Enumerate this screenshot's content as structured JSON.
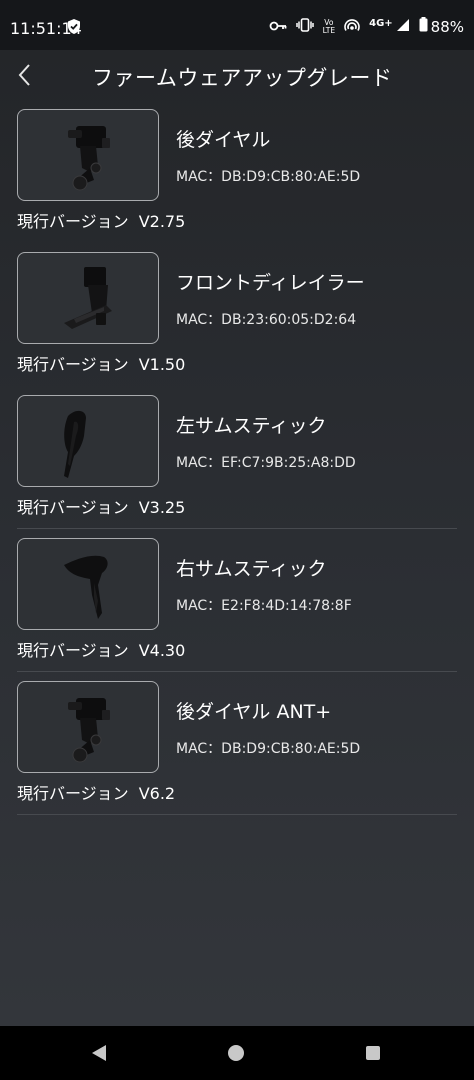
{
  "status_bar": {
    "time": "11:51:14",
    "network": "4G+",
    "volte_top": "Vo",
    "volte_bottom": "LTE",
    "battery": "88%"
  },
  "header": {
    "title": "ファームウェアアップグレード"
  },
  "devices": [
    {
      "name": "後ダイヤル",
      "mac": "MAC：DB:D9:CB:80:AE:5D",
      "version_label": "現行バージョン",
      "version": "V2.75"
    },
    {
      "name": "フロントディレイラー",
      "mac": "MAC：DB:23:60:05:D2:64",
      "version_label": "現行バージョン",
      "version": "V1.50"
    },
    {
      "name": "左サムスティック",
      "mac": "MAC：EF:C7:9B:25:A8:DD",
      "version_label": "現行バージョン",
      "version": "V3.25"
    },
    {
      "name": "右サムスティック",
      "mac": "MAC：E2:F8:4D:14:78:8F",
      "version_label": "現行バージョン",
      "version": "V4.30"
    },
    {
      "name": "後ダイヤル ANT+",
      "mac": "MAC：DB:D9:CB:80:AE:5D",
      "version_label": "現行バージョン",
      "version": "V6.2"
    }
  ],
  "icons": {
    "back": "chevron-left-icon",
    "shield": "shield-check-icon",
    "key": "key-icon",
    "vibrate": "vibrate-icon",
    "hotspot": "hotspot-icon",
    "signal": "signal-icon",
    "battery": "battery-icon",
    "nav_back": "triangle-back-icon",
    "nav_home": "circle-home-icon",
    "nav_recent": "square-recent-icon"
  },
  "colors": {
    "status_bar_bg": "#15171a",
    "screen_bg": "#2b2e33",
    "card_border": "#a9abae",
    "divider": "#474a4f",
    "nav_bar_bg": "#000000"
  }
}
